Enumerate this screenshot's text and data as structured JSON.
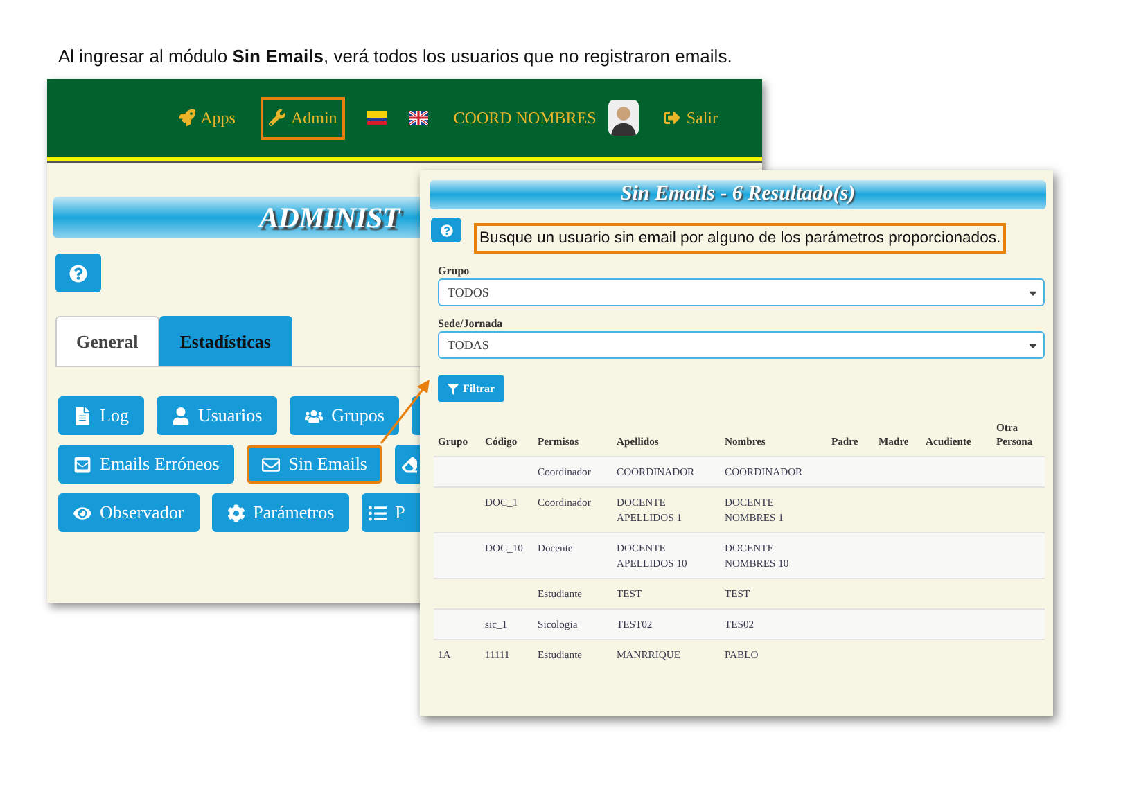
{
  "caption": "Al ingresar al módulo  **Sin Emails**, verá todos los usuarios que no registraron emails.",
  "admin_screen": {
    "nav": [
      {
        "kind": "link",
        "label": "Apps",
        "highlighted": false
      },
      {
        "kind": "link",
        "label": "Admin",
        "highlighted": true
      },
      {
        "kind": "flag"
      },
      {
        "kind": "flag"
      },
      {
        "kind": "user",
        "label": "COORD NOMBRES"
      },
      {
        "kind": "link",
        "label": "Salir",
        "highlighted": false
      }
    ],
    "banner": "ADMINIST",
    "tabs": [
      {
        "label": "General",
        "selected": true
      },
      {
        "label": "Estadísticas",
        "selected": false
      }
    ],
    "button_rows": [
      [
        {
          "label": "Log",
          "highlighted": false
        },
        {
          "label": "Usuarios",
          "highlighted": false
        },
        {
          "label": "Grupos",
          "highlighted": false
        },
        {
          "kind": "partial"
        }
      ],
      [
        {
          "label": "Emails Erróneos",
          "highlighted": false
        },
        {
          "label": "Sin Emails",
          "highlighted": true
        },
        {
          "kind": "partial"
        }
      ],
      [
        {
          "label": "Observador",
          "highlighted": false
        },
        {
          "label": "Parámetros",
          "highlighted": false
        },
        {
          "kind": "partial",
          "label": "P"
        }
      ]
    ]
  },
  "results_screen": {
    "title": "Sin Emails - 6 Resultado(s)",
    "hint": "Busque un usuario sin email por alguno de los parámetros proporcionados.",
    "filters": [
      {
        "label": "Grupo",
        "value": "TODOS"
      },
      {
        "label": "Sede/Jornada",
        "value": "TODAS"
      }
    ],
    "filter_button": "Filtrar",
    "table": {
      "columns": [
        "Grupo",
        "Código",
        "Permisos",
        "Apellidos",
        "Nombres",
        "Padre",
        "Madre",
        "Acudiente",
        "Otra Persona"
      ],
      "rows": [
        [
          "",
          "",
          "Coordinador",
          "COORDINADOR",
          "COORDINADOR"
        ],
        [
          "",
          "DOC_1",
          "Coordinador",
          "DOCENTE APELLIDOS 1",
          "DOCENTE NOMBRES 1"
        ],
        [
          "",
          "DOC_10",
          "Docente",
          "DOCENTE APELLIDOS 10",
          "DOCENTE NOMBRES 10"
        ],
        [
          "",
          "",
          "Estudiante",
          "TEST",
          "TEST"
        ],
        [
          "",
          "sic_1",
          "Sicologia",
          "TEST02",
          "TES02"
        ],
        [
          "1A",
          "11111",
          "Estudiante",
          "MANRRIQUE",
          "PABLO"
        ]
      ]
    }
  }
}
